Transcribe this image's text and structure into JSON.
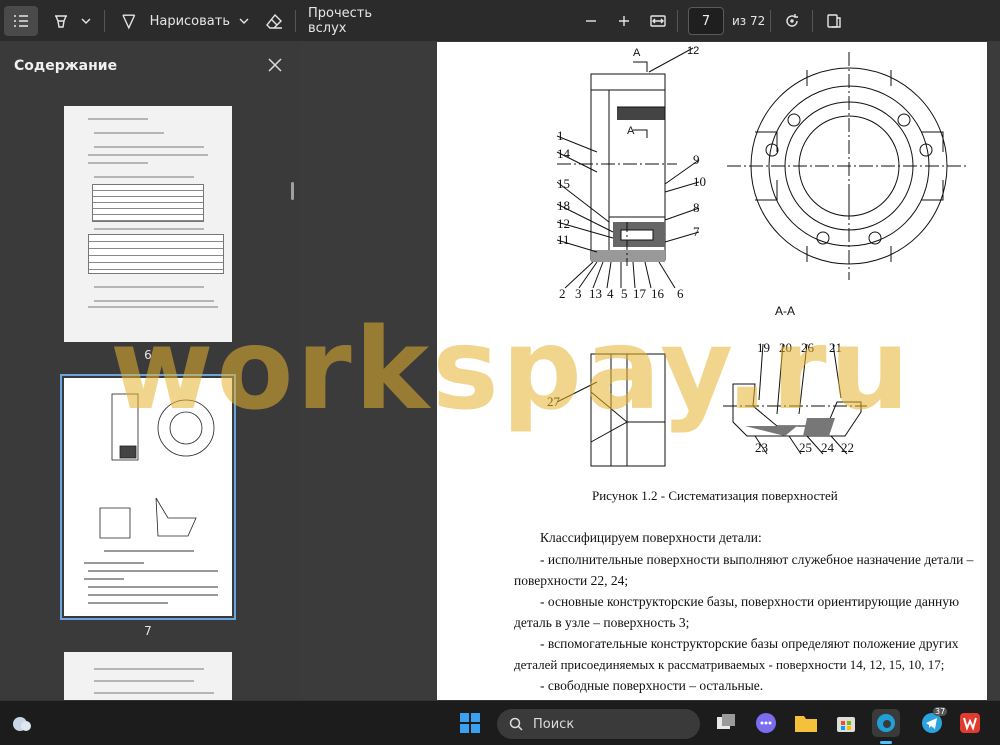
{
  "toolbar": {
    "draw_label": "Нарисовать",
    "read_aloud_label": "Прочесть вслух",
    "current_page": "7",
    "total_pages_label": "из 72"
  },
  "sidebar": {
    "title": "Содержание",
    "thumbnails": [
      {
        "label": "6"
      },
      {
        "label": "7"
      }
    ]
  },
  "document": {
    "figure_caption": "Рисунок 1.2 - Систематизация  поверхностей",
    "section_label": "А-А",
    "callout_a": "А",
    "callouts_left": [
      "1",
      "14",
      "15",
      "18",
      "12",
      "11"
    ],
    "callouts_right": [
      "12",
      "9",
      "10",
      "8",
      "7"
    ],
    "callouts_bottom": [
      "2",
      "3",
      "13",
      "4",
      "5",
      "17",
      "16",
      "6"
    ],
    "callouts_section_top": [
      "19",
      "20",
      "26",
      "21"
    ],
    "callouts_section_bottom": [
      "23",
      "25",
      "24",
      "22"
    ],
    "callout_27": "27",
    "paragraphs": [
      "Классифицируем поверхности детали:",
      "- исполнительные поверхности выполняют служебное назначение детали –",
      "поверхности 22, 24;",
      "- основные конструкторские базы, поверхности ориентирующие данную",
      "деталь в узле – поверхность  3;",
      "- вспомогательные конструкторские базы определяют положение других",
      "деталей присоединяемых к рассматриваемых - поверхности 14, 12, 15, 10, 17;",
      "- свободные поверхности – остальные."
    ]
  },
  "watermark": "workspay.ru",
  "taskbar": {
    "search_label": "Поиск",
    "telegram_badge": "37"
  }
}
